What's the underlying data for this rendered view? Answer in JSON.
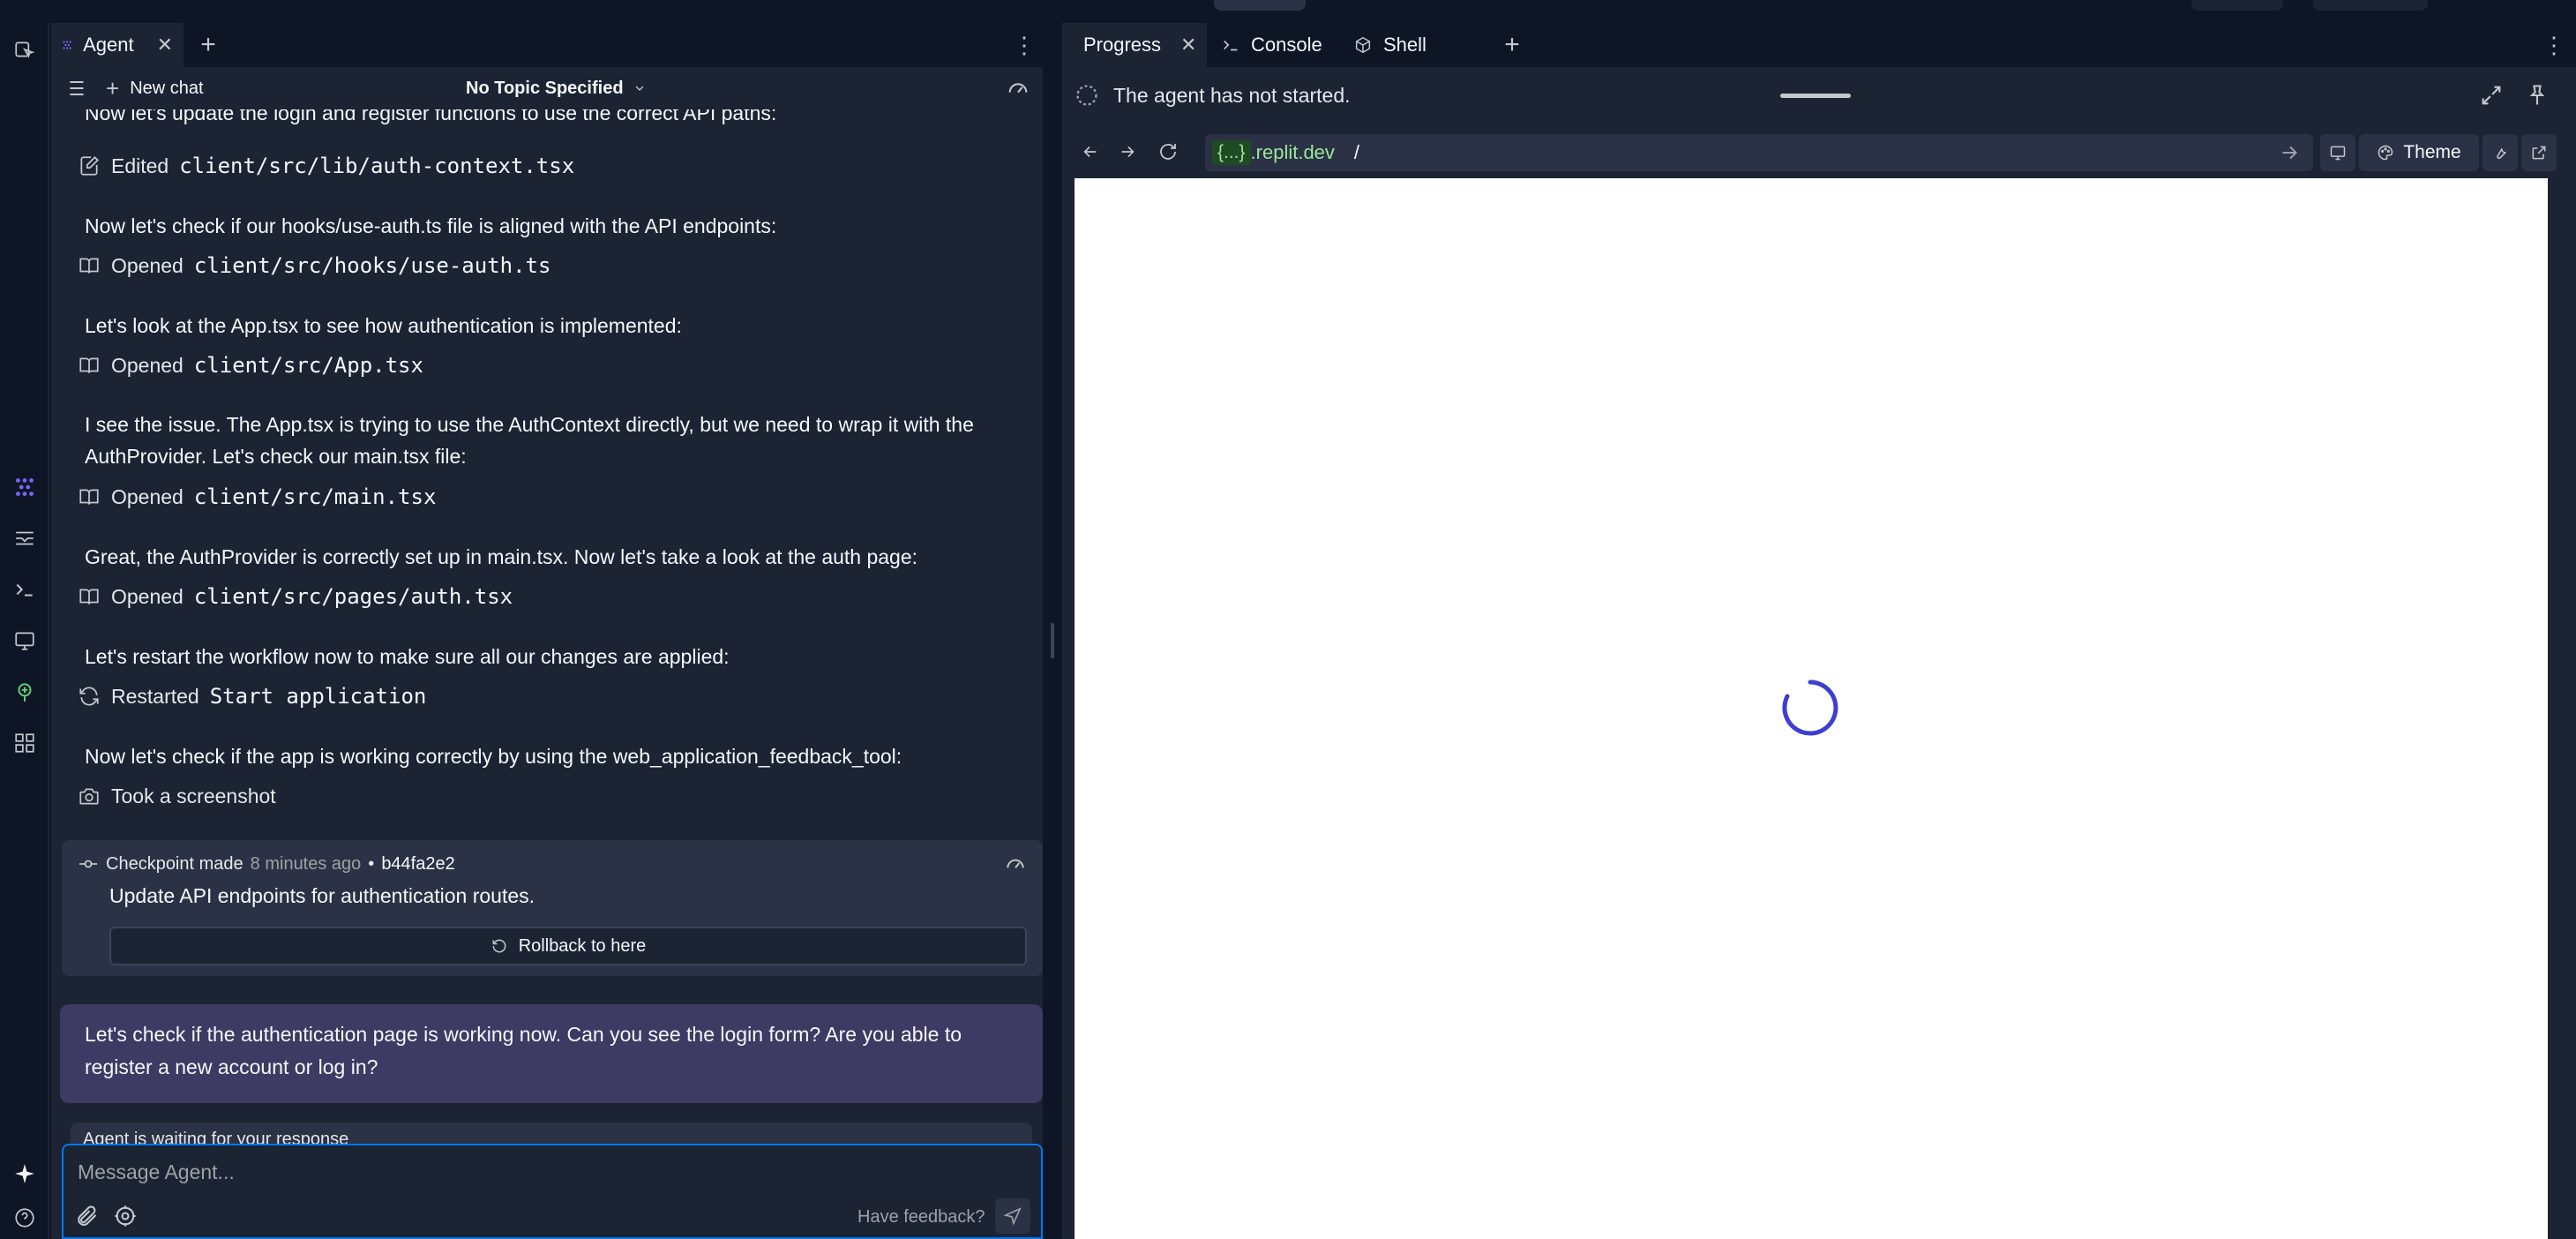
{
  "agent_panel": {
    "tab_label": "Agent",
    "new_chat_label": "New chat",
    "topic_label": "No Topic Specified",
    "clipped_message": "Now let's update the login and register functions to use the correct API paths:",
    "feed": [
      {
        "kind": "action",
        "verb": "Edited",
        "path": "client/src/lib/auth-context.tsx",
        "icon": "edit-icon"
      },
      {
        "kind": "message",
        "text": "Now let's check if our hooks/use-auth.ts file is aligned with the API endpoints:"
      },
      {
        "kind": "action",
        "verb": "Opened",
        "path": "client/src/hooks/use-auth.ts",
        "icon": "book-icon"
      },
      {
        "kind": "message",
        "text": "Let's look at the App.tsx to see how authentication is implemented:"
      },
      {
        "kind": "action",
        "verb": "Opened",
        "path": "client/src/App.tsx",
        "icon": "book-icon"
      },
      {
        "kind": "message",
        "text": "I see the issue. The App.tsx is trying to use the AuthContext directly, but we need to wrap it with the AuthProvider. Let's check our main.tsx file:"
      },
      {
        "kind": "action",
        "verb": "Opened",
        "path": "client/src/main.tsx",
        "icon": "book-icon"
      },
      {
        "kind": "message",
        "text": "Great, the AuthProvider is correctly set up in main.tsx. Now let's take a look at the auth page:"
      },
      {
        "kind": "action",
        "verb": "Opened",
        "path": "client/src/pages/auth.tsx",
        "icon": "book-icon"
      },
      {
        "kind": "message",
        "text": "Let's restart the workflow now to make sure all our changes are applied:"
      },
      {
        "kind": "action",
        "verb": "Restarted",
        "path": "Start application",
        "icon": "restart-icon"
      },
      {
        "kind": "message",
        "text": "Now let's check if the app is working correctly by using the web_application_feedback_tool:"
      },
      {
        "kind": "action",
        "verb": "Took a screenshot",
        "path": "",
        "icon": "camera-icon"
      }
    ],
    "checkpoint": {
      "label": "Checkpoint made",
      "ago": "8 minutes ago",
      "separator": "•",
      "hash": "b44fa2e2",
      "title": "Update API endpoints for authentication routes.",
      "rollback_label": "Rollback to here"
    },
    "question": "Let's check if the authentication page is working now. Can you see the login form? Are you able to register a new account or log in?",
    "waiting_text": "Agent is waiting for your response",
    "composer": {
      "placeholder": "Message Agent...",
      "feedback_label": "Have feedback?"
    }
  },
  "right_panel": {
    "tabs": [
      {
        "label": "Progress",
        "icon": "progress-icon",
        "active": true
      },
      {
        "label": "Console",
        "icon": "terminal-icon",
        "active": false
      },
      {
        "label": "Shell",
        "icon": "shell-icon",
        "active": false
      }
    ],
    "status_text": "The agent has not started.",
    "url": {
      "host_pill": "{...}",
      "host": ".replit.dev",
      "path": "/"
    },
    "theme_label": "Theme"
  },
  "colors": {
    "background": "#0e1525",
    "panel": "#1c2333",
    "surface": "#2b3245",
    "question_bubble": "#3d3a63",
    "accent_blue": "#0079f2",
    "brand_purple": "#7c65f6",
    "url_green": "#9ce79a",
    "spinner": "#3e3ed0"
  }
}
